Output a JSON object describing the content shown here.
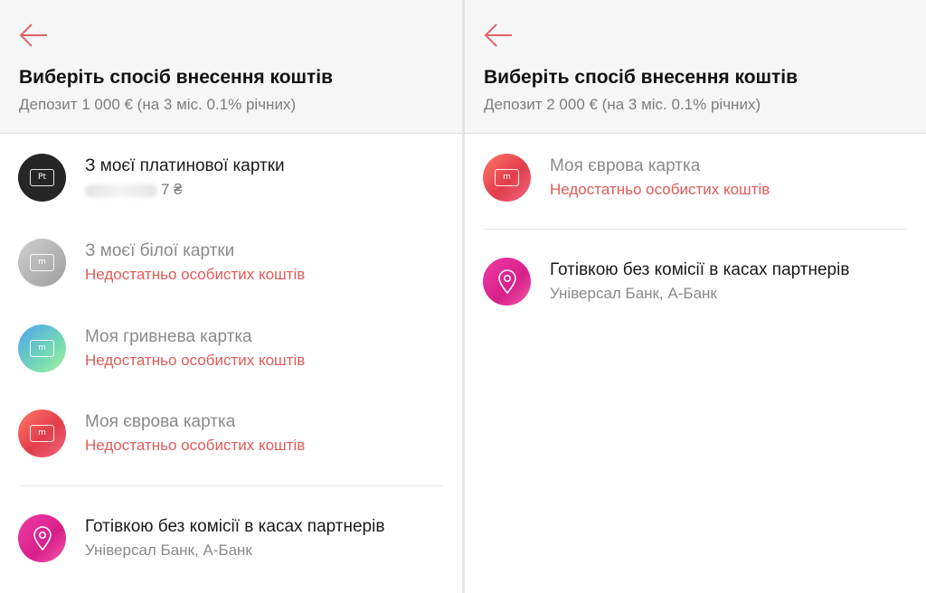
{
  "left": {
    "header": {
      "title": "Виберіть спосіб внесення коштів",
      "subtitle": "Депозит 1 000 € (на 3 міс. 0.1% річних)"
    },
    "items": [
      {
        "title": "З моєї платинової картки",
        "sub": "7 ₴",
        "icon": "platinum-card-icon",
        "glyph": "Pt"
      },
      {
        "title": "З моєї білої картки",
        "sub": "Недостатньо особистих коштів",
        "icon": "white-card-icon",
        "glyph": "m"
      },
      {
        "title": "Моя гривнева картка",
        "sub": "Недостатньо особистих коштів",
        "icon": "uah-card-icon",
        "glyph": "m"
      },
      {
        "title": "Моя єврова картка",
        "sub": "Недостатньо особистих коштів",
        "icon": "eur-card-icon",
        "glyph": "m"
      },
      {
        "title": "Готівкою без комісії в касах партнерів",
        "sub": "Універсал Банк, А-Банк",
        "icon": "location-pin-icon"
      }
    ]
  },
  "right": {
    "header": {
      "title": "Виберіть спосіб внесення коштів",
      "subtitle": "Депозит 2 000 € (на 3 міс. 0.1% річних)"
    },
    "items": [
      {
        "title": "Моя єврова картка",
        "sub": "Недостатньо особистих коштів",
        "icon": "eur-card-icon",
        "glyph": "m"
      },
      {
        "title": "Готівкою без комісії в касах партнерів",
        "sub": "Універсал Банк, А-Банк",
        "icon": "location-pin-icon"
      }
    ]
  },
  "colors": {
    "accent_red": "#e25a5a",
    "header_bg": "#f6f6f6"
  }
}
